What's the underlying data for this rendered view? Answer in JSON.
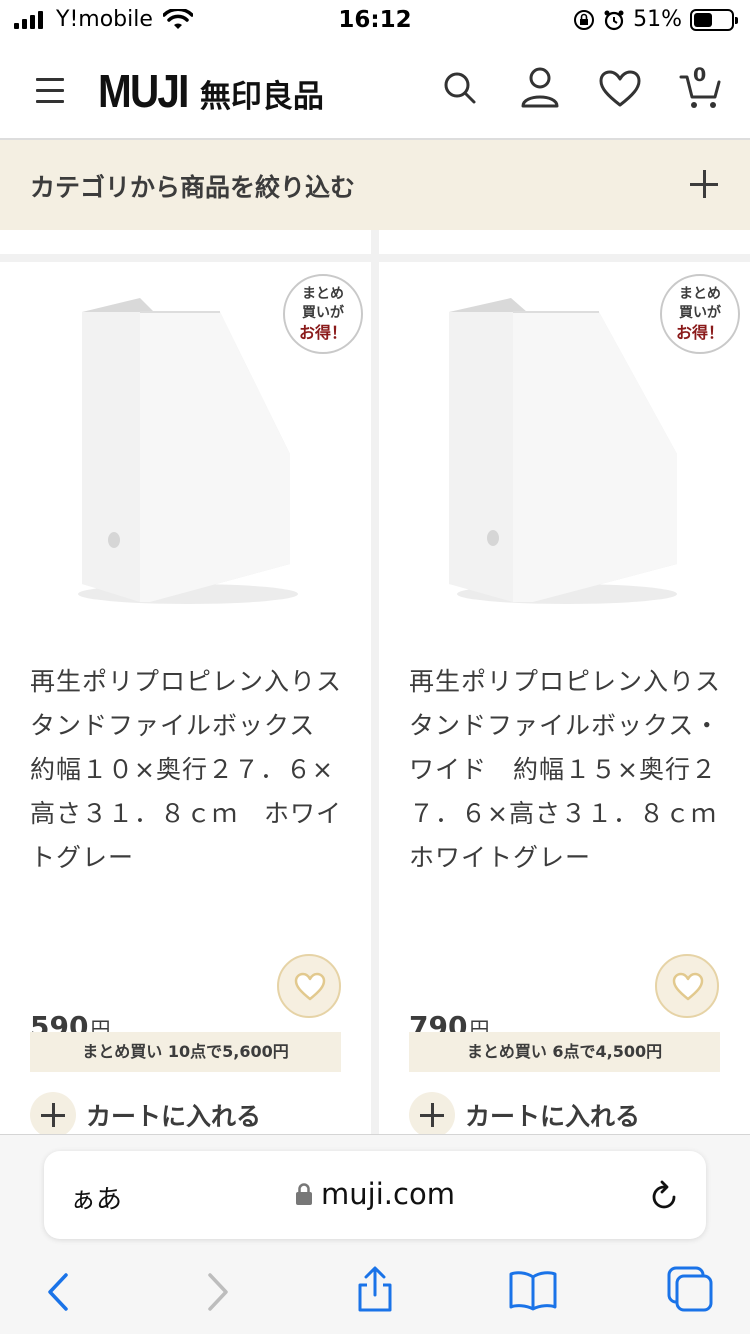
{
  "status": {
    "carrier": "Y!mobile",
    "time": "16:12",
    "battery": "51%",
    "battery_level": 0.51
  },
  "header": {
    "logo_en": "MUJI",
    "logo_jp": "無印良品",
    "cart_count": "0",
    "icons": [
      "menu-icon",
      "search-icon",
      "user-icon",
      "heart-icon",
      "cart-icon"
    ]
  },
  "filter": {
    "label": "カテゴリから商品を絞り込む"
  },
  "products": [
    {
      "badge": [
        "まとめ",
        "買いが",
        "お得！"
      ],
      "title": "再生ポリプロピレン入りスタンドファイルボックス　約幅１０×奥行２７．６×高さ３１．８ｃｍ　ホワイトグレー",
      "price": "590",
      "currency": "円",
      "bulk": "まとめ買い 10点で5,600円",
      "add_to_cart": "カートに入れる"
    },
    {
      "badge": [
        "まとめ",
        "買いが",
        "お得！"
      ],
      "title": "再生ポリプロピレン入りスタンドファイルボックス・ワイド　約幅１５×奥行２７．６×高さ３１．８ｃｍ　ホワイトグレー",
      "price": "790",
      "currency": "円",
      "bulk": "まとめ買い 6点で4,500円",
      "add_to_cart": "カートに入れる"
    }
  ],
  "browser": {
    "text_size": "ぁあ",
    "url": "muji.com"
  },
  "colors": {
    "beige": "#f4efe2",
    "badge_accent": "#8a1a1a",
    "ios_blue": "#1a73e8"
  }
}
